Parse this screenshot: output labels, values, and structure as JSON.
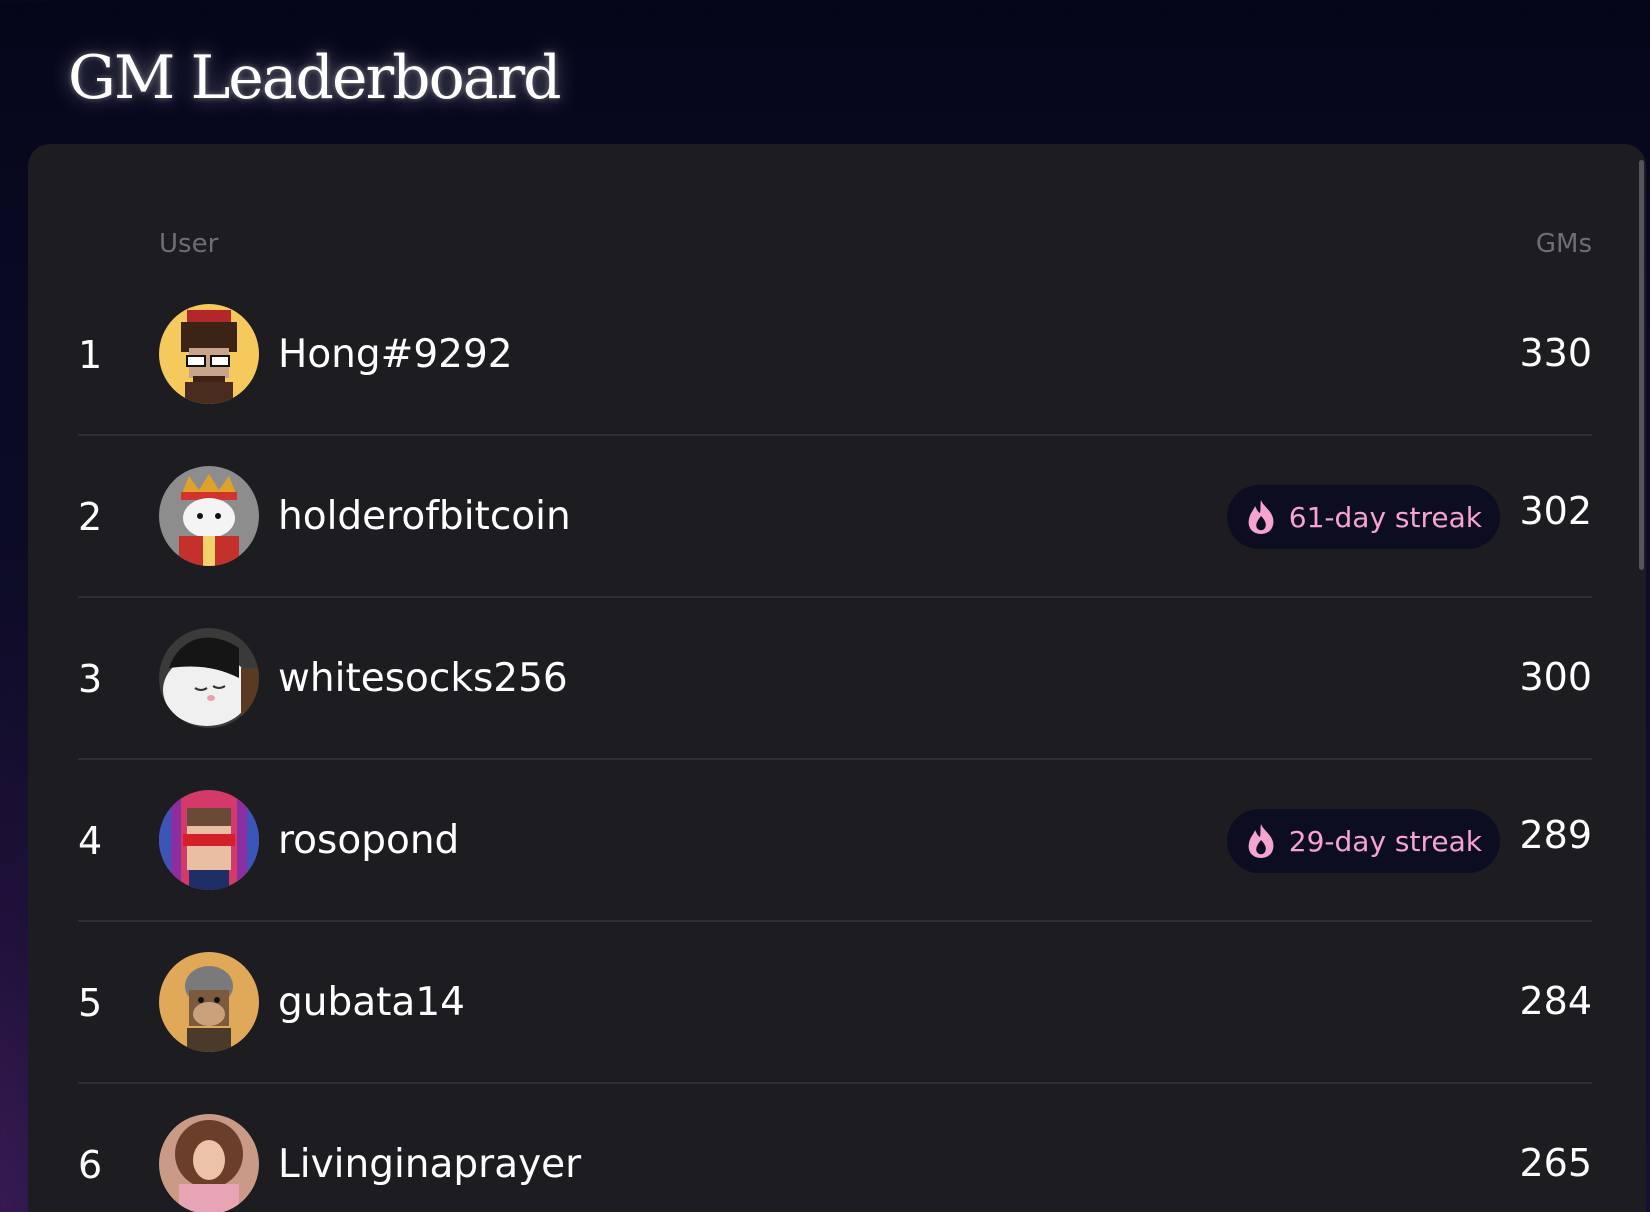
{
  "header": {
    "title": "GM Leaderboard"
  },
  "table": {
    "columns": {
      "user": "User",
      "gms": "GMs"
    },
    "rows": [
      {
        "rank": "1",
        "username": "Hong#9292",
        "gms": "330",
        "streak": ""
      },
      {
        "rank": "2",
        "username": "holderofbitcoin",
        "gms": "302",
        "streak": "61-day streak"
      },
      {
        "rank": "3",
        "username": "whitesocks256",
        "gms": "300",
        "streak": ""
      },
      {
        "rank": "4",
        "username": "rosopond",
        "gms": "289",
        "streak": "29-day streak"
      },
      {
        "rank": "5",
        "username": "gubata14",
        "gms": "284",
        "streak": ""
      },
      {
        "rank": "6",
        "username": "Livinginaprayer",
        "gms": "265",
        "streak": ""
      }
    ]
  },
  "icons": {
    "streak": "flame-icon"
  },
  "colors": {
    "streak_text": "#f5a3cf",
    "streak_bg": "#0d0d22",
    "panel_bg": "#1c1c21",
    "header_text": "#6d6d74"
  }
}
